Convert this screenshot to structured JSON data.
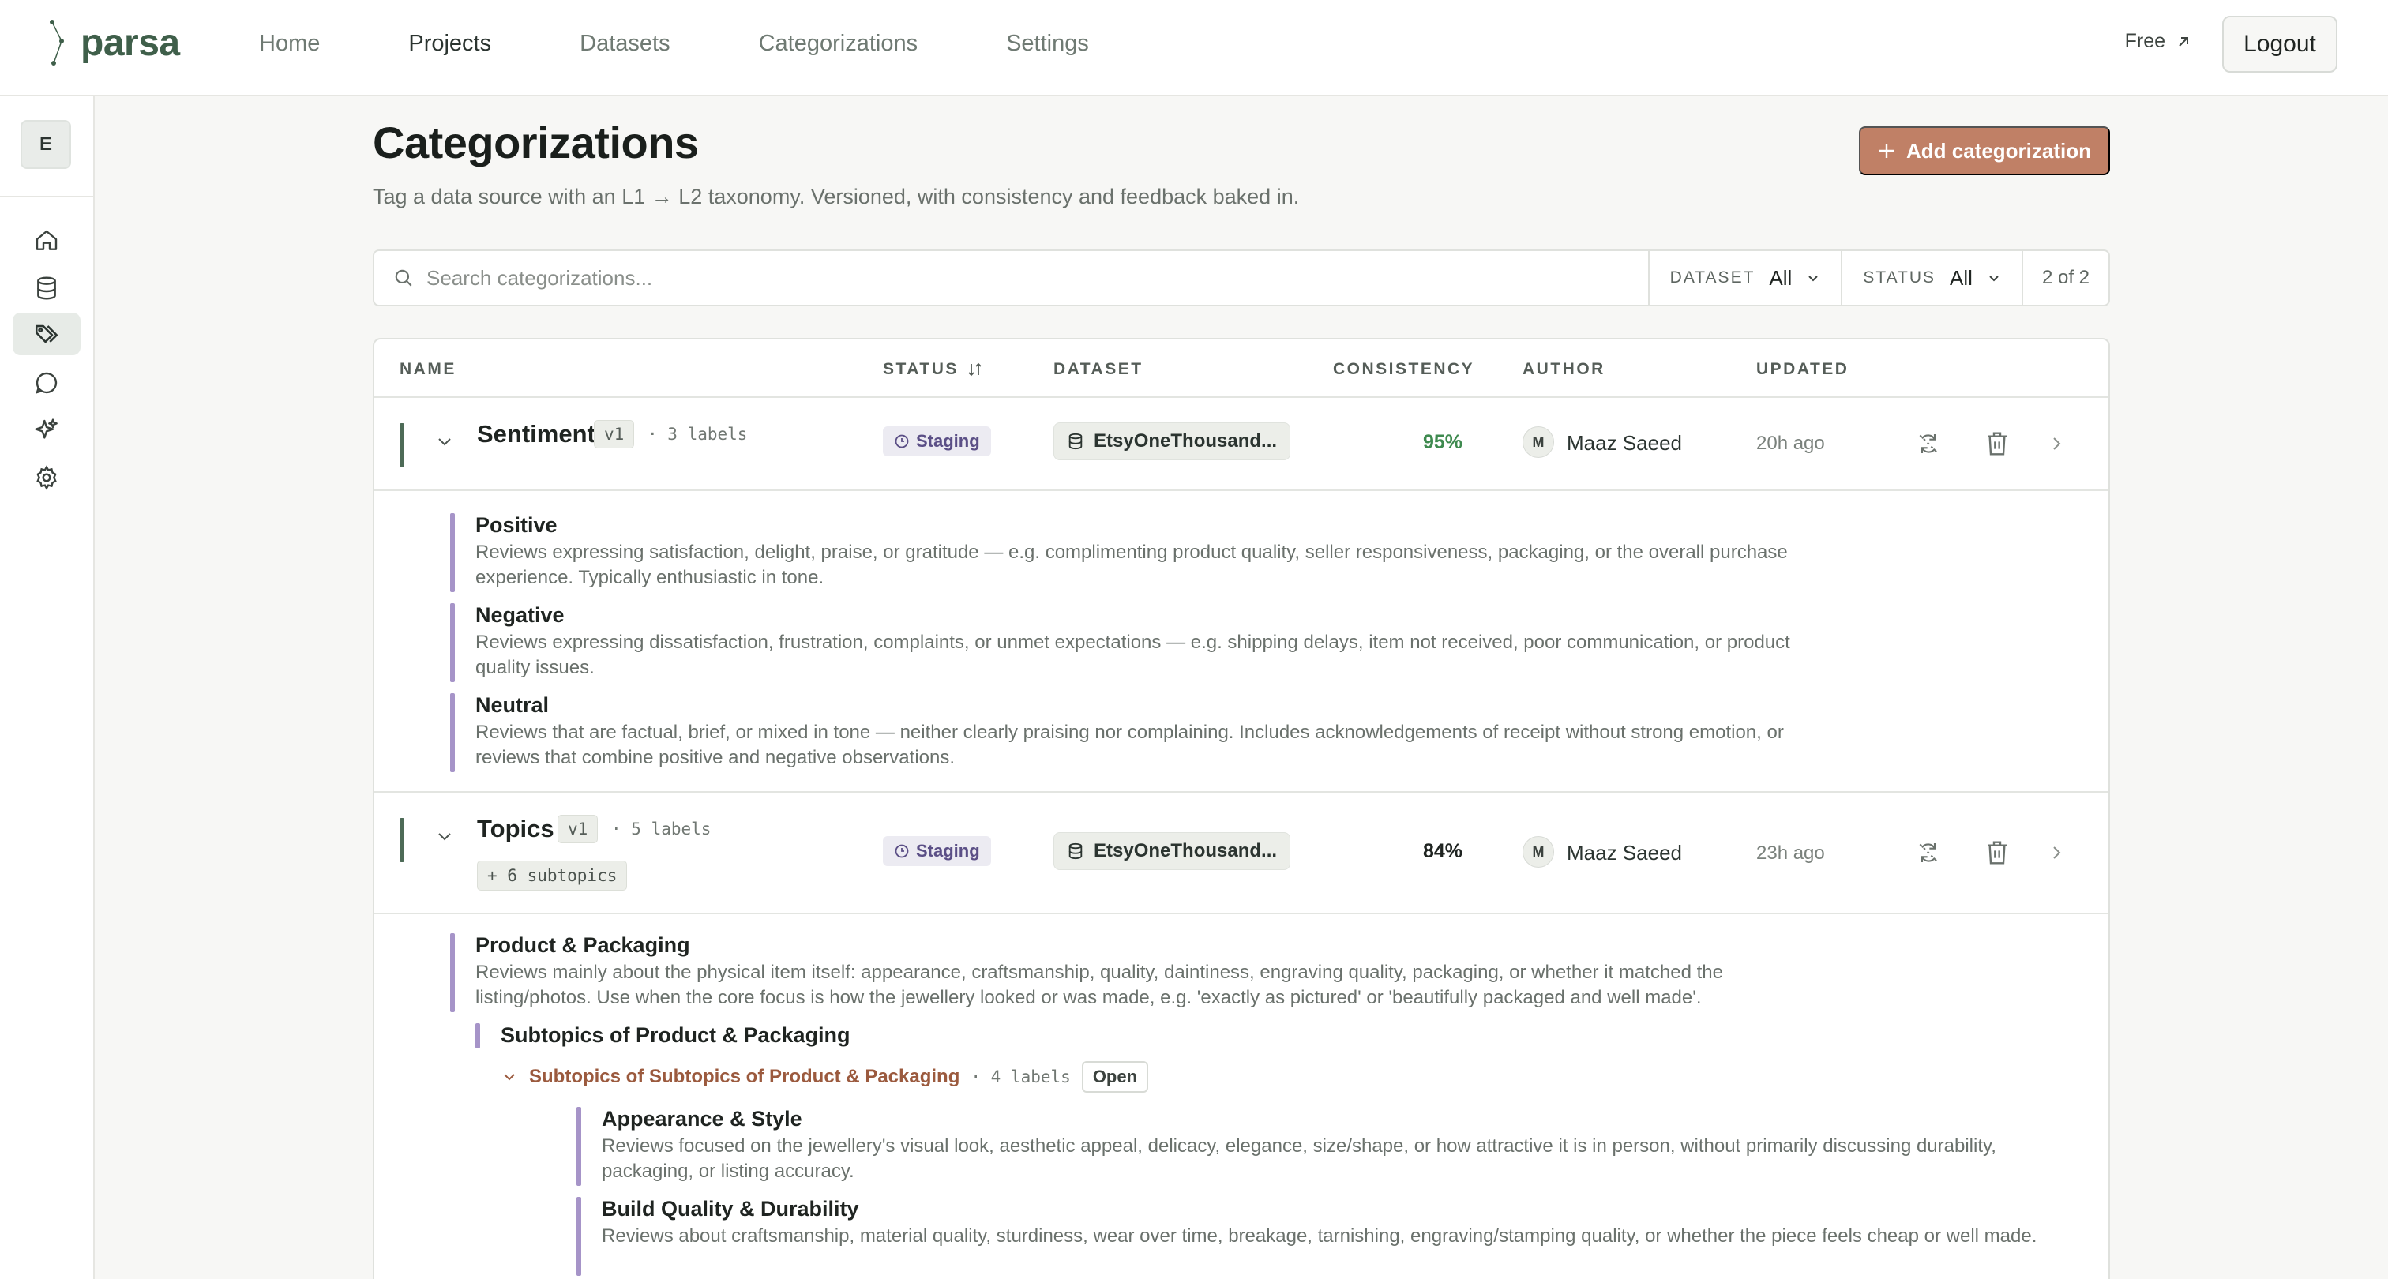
{
  "app": {
    "brand": "parsa",
    "nav": [
      "Home",
      "Projects",
      "Datasets",
      "Categorizations",
      "Settings"
    ],
    "free_label": "Free",
    "logout_label": "Logout"
  },
  "sidebar": {
    "workspace_initial": "E",
    "icons": [
      "home-icon",
      "database-icon",
      "tags-icon",
      "chat-icon",
      "sparkles-icon",
      "gear-icon"
    ],
    "active": "tags-icon"
  },
  "page": {
    "title": "Categorizations",
    "subtitle": "Tag a data source with an L1 → L2 taxonomy. Versioned, with consistency and feedback baked in.",
    "add_button": "Add categorization"
  },
  "filters": {
    "search_placeholder": "Search categorizations...",
    "dataset_label": "DATASET",
    "dataset_value": "All",
    "status_label": "STATUS",
    "status_value": "All",
    "count": "2 of 2"
  },
  "table": {
    "columns": [
      "NAME",
      "STATUS",
      "DATASET",
      "CONSISTENCY",
      "AUTHOR",
      "UPDATED"
    ],
    "rows": [
      {
        "name": "Sentiment",
        "version": "v1",
        "labels_count": "· 3 labels",
        "status": "Staging",
        "dataset": "EtsyOneThousand...",
        "consistency": "95%",
        "author_initial": "M",
        "author": "Maaz Saeed",
        "updated": "20h ago",
        "labels": [
          {
            "title": "Positive",
            "desc": "Reviews expressing satisfaction, delight, praise, or gratitude — e.g. complimenting product quality, seller responsiveness, packaging, or the overall purchase experience. Typically enthusiastic in tone."
          },
          {
            "title": "Negative",
            "desc": "Reviews expressing dissatisfaction, frustration, complaints, or unmet expectations — e.g. shipping delays, item not received, poor communication, or product quality issues."
          },
          {
            "title": "Neutral",
            "desc": "Reviews that are factual, brief, or mixed in tone — neither clearly praising nor complaining. Includes acknowledgements of receipt without strong emotion, or reviews that combine positive and negative observations."
          }
        ]
      },
      {
        "name": "Topics",
        "version": "v1",
        "labels_count": "· 5 labels",
        "subtopics": "+ 6 subtopics",
        "status": "Staging",
        "dataset": "EtsyOneThousand...",
        "consistency": "84%",
        "author_initial": "M",
        "author": "Maaz Saeed",
        "updated": "23h ago",
        "labels": [
          {
            "title": "Product & Packaging",
            "desc": "Reviews mainly about the physical item itself: appearance, craftsmanship, quality, daintiness, engraving quality, packaging, or whether it matched the listing/photos. Use when the core focus is how the jewellery looked or was made, e.g. 'exactly as pictured' or 'beautifully packaged and well made'."
          }
        ],
        "subgroup_title": "Subtopics of Product & Packaging",
        "subsub_title": "Subtopics of Subtopics of Product & Packaging",
        "subsub_labels_count": "· 4 labels",
        "open_label": "Open",
        "sublabels": [
          {
            "title": "Appearance & Style",
            "desc": "Reviews focused on the jewellery's visual look, aesthetic appeal, delicacy, elegance, size/shape, or how attractive it is in person, without primarily discussing durability, packaging, or listing accuracy."
          },
          {
            "title": "Build Quality & Durability",
            "desc": "Reviews about craftsmanship, material quality, sturdiness, wear over time, breakage, tarnishing, engraving/stamping quality, or whether the piece feels cheap or well made."
          }
        ]
      }
    ]
  },
  "colors": {
    "accent": "#c08066",
    "brand": "#3f5f4a",
    "label_bar": "#a694c8",
    "consistency_high": "#3e8a4f",
    "status": "#5b4f86"
  }
}
